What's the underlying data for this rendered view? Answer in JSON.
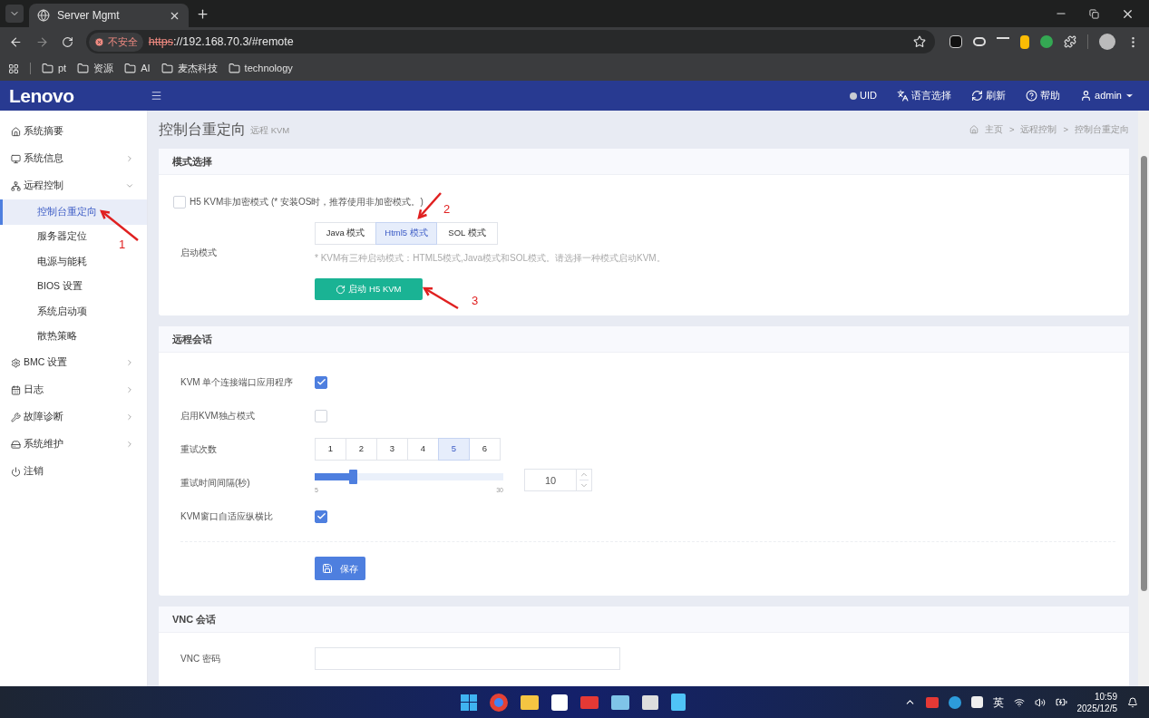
{
  "browser": {
    "tab": {
      "title": "Server Mgmt"
    },
    "security": "不安全",
    "url": {
      "scheme": "https",
      "rest": "://192.168.70.3/#remote"
    },
    "bookmarks": [
      "pt",
      "资源",
      "AI",
      "麦杰科技",
      "technology"
    ]
  },
  "header": {
    "logo": "Lenovo",
    "actions": [
      {
        "label": "UID",
        "kind": "dot"
      },
      {
        "label": "语言选择",
        "kind": "language"
      },
      {
        "label": "刷新",
        "kind": "refresh"
      },
      {
        "label": "帮助",
        "kind": "help"
      },
      {
        "label": "admin",
        "kind": "user"
      }
    ]
  },
  "sidebar": {
    "items": [
      {
        "label": "系统摘要",
        "kind": "link"
      },
      {
        "label": "系统信息",
        "kind": "group",
        "expanded": false
      },
      {
        "label": "远程控制",
        "kind": "group",
        "expanded": true,
        "children": [
          {
            "label": "控制台重定向",
            "selected": true
          },
          {
            "label": "服务器定位",
            "selected": false
          },
          {
            "label": "电源与能耗",
            "selected": false
          },
          {
            "label": "BIOS 设置",
            "selected": false
          },
          {
            "label": "系统启动项",
            "selected": false
          },
          {
            "label": "散热策略",
            "selected": false
          }
        ]
      },
      {
        "label": "BMC 设置",
        "kind": "group",
        "expanded": false
      },
      {
        "label": "日志",
        "kind": "group",
        "expanded": false
      },
      {
        "label": "故障诊断",
        "kind": "group",
        "expanded": false
      },
      {
        "label": "系统维护",
        "kind": "group",
        "expanded": false
      },
      {
        "label": "注销",
        "kind": "link"
      }
    ]
  },
  "page": {
    "title": "控制台重定向",
    "subtitle": "远程 KVM",
    "breadcrumb": [
      "主页",
      "远程控制",
      "控制台重定向"
    ],
    "breadcrumb_separator": ">"
  },
  "mode_card": {
    "title": "模式选择",
    "unencrypted": {
      "label": "H5 KVM非加密模式 (* 安装OS时，推荐使用非加密模式。)",
      "checked": false
    },
    "launch_label": "启动模式",
    "modes": [
      {
        "label": "Java 模式",
        "selected": false
      },
      {
        "label": "Html5 模式",
        "selected": true
      },
      {
        "label": "SOL 模式",
        "selected": false
      }
    ],
    "hint": "* KVM有三种启动模式：HTML5模式,Java模式和SOL模式。请选择一种模式启动KVM。",
    "start_button": "启动 H5 KVM"
  },
  "session_card": {
    "title": "远程会话",
    "rows": [
      {
        "kind": "checkbox",
        "label": "KVM 单个连接端口应用程序",
        "checked": true
      },
      {
        "kind": "checkbox",
        "label": "启用KVM独占模式",
        "checked": false
      },
      {
        "kind": "segmented",
        "label": "重试次数",
        "options": [
          {
            "label": "1",
            "selected": false
          },
          {
            "label": "2",
            "selected": false
          },
          {
            "label": "3",
            "selected": false
          },
          {
            "label": "4",
            "selected": false
          },
          {
            "label": "5",
            "selected": true
          },
          {
            "label": "6",
            "selected": false
          }
        ]
      },
      {
        "kind": "slider",
        "label": "重试时间间隔(秒)",
        "level": 0.2,
        "min": "5",
        "max": "30",
        "value": "10"
      },
      {
        "kind": "checkbox",
        "label": "KVM窗口自适应纵横比",
        "checked": true
      }
    ],
    "save_button": "保存"
  },
  "vnc_card": {
    "title": "VNC 会话",
    "fields": [
      {
        "label": "VNC 密码"
      }
    ]
  },
  "annotations": [
    "1",
    "2",
    "3"
  ],
  "taskbar": {
    "ime": "英",
    "time": "10:59",
    "date": "2025/12/5"
  }
}
